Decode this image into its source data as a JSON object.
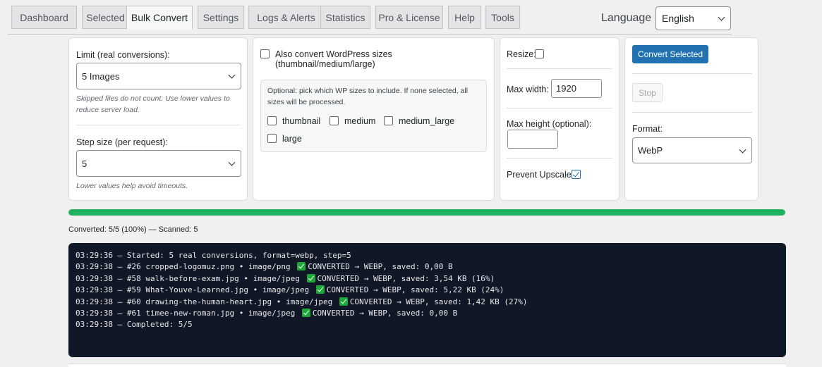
{
  "tabs": [
    {
      "label": "Dashboard"
    },
    {
      "label": "Selected"
    },
    {
      "label": "Bulk Convert",
      "active": true
    },
    {
      "label": "Settings"
    },
    {
      "label": "Logs & Alerts"
    },
    {
      "label": "Statistics"
    },
    {
      "label": "Pro & License"
    },
    {
      "label": "Help"
    },
    {
      "label": "Tools"
    }
  ],
  "language": {
    "label": "Language",
    "value": "English"
  },
  "limit": {
    "label": "Limit (real conversions):",
    "value": "5 Images",
    "hint": "Skipped files do not count. Use lower values to reduce server load."
  },
  "step": {
    "label": "Step size (per request):",
    "value": "5",
    "hint": "Lower values help avoid timeouts."
  },
  "wp_sizes": {
    "toggle_label": "Also convert WordPress sizes (thumbnail/medium/large)",
    "toggle_checked": false,
    "note": "Optional: pick which WP sizes to include. If none selected, all sizes will be processed.",
    "sizes": [
      {
        "label": "thumbnail",
        "checked": false
      },
      {
        "label": "medium",
        "checked": false
      },
      {
        "label": "medium_large",
        "checked": false
      },
      {
        "label": "large",
        "checked": false
      }
    ]
  },
  "resize": {
    "label": "Resize:",
    "checked": false,
    "max_width_label": "Max width:",
    "max_width_value": "1920",
    "max_height_label": "Max height (optional):",
    "max_height_value": "",
    "prevent_upscale_label": "Prevent Upscale:",
    "prevent_upscale_checked": true
  },
  "actions": {
    "convert_label": "Convert Selected",
    "stop_label": "Stop",
    "format_label": "Format:",
    "format_value": "WebP"
  },
  "progress": {
    "percent": 100,
    "status": "Converted: 5/5 (100%) — Scanned: 5"
  },
  "log": [
    {
      "pre": "03:29:36 — Started: 5 real conversions, format=webp, step=5",
      "ok": false,
      "post": ""
    },
    {
      "pre": "03:29:38 — #26 cropped-logomuz.png • image/png",
      "ok": true,
      "post": "CONVERTED → WEBP, saved: 0,00 B"
    },
    {
      "pre": "03:29:38 — #58 walk-before-exam.jpg • image/jpeg",
      "ok": true,
      "post": "CONVERTED → WEBP, saved: 3,54 KB (16%)"
    },
    {
      "pre": "03:29:38 — #59 What-Youve-Learned.jpg • image/jpeg",
      "ok": true,
      "post": "CONVERTED → WEBP, saved: 5,22 KB (24%)"
    },
    {
      "pre": "03:29:38 — #60 drawing-the-human-heart.jpg • image/jpeg",
      "ok": true,
      "post": "CONVERTED → WEBP, saved: 1,42 KB (27%)"
    },
    {
      "pre": "03:29:38 — #61 timee-new-roman.jpg • image/jpeg",
      "ok": true,
      "post": "CONVERTED → WEBP, saved: 0,00 B"
    },
    {
      "pre": "03:29:38 — Completed: 5/5",
      "ok": false,
      "post": ""
    }
  ],
  "colors": {
    "accent": "#2271b1",
    "progress": "#1fb35f",
    "log_bg": "#101827"
  }
}
